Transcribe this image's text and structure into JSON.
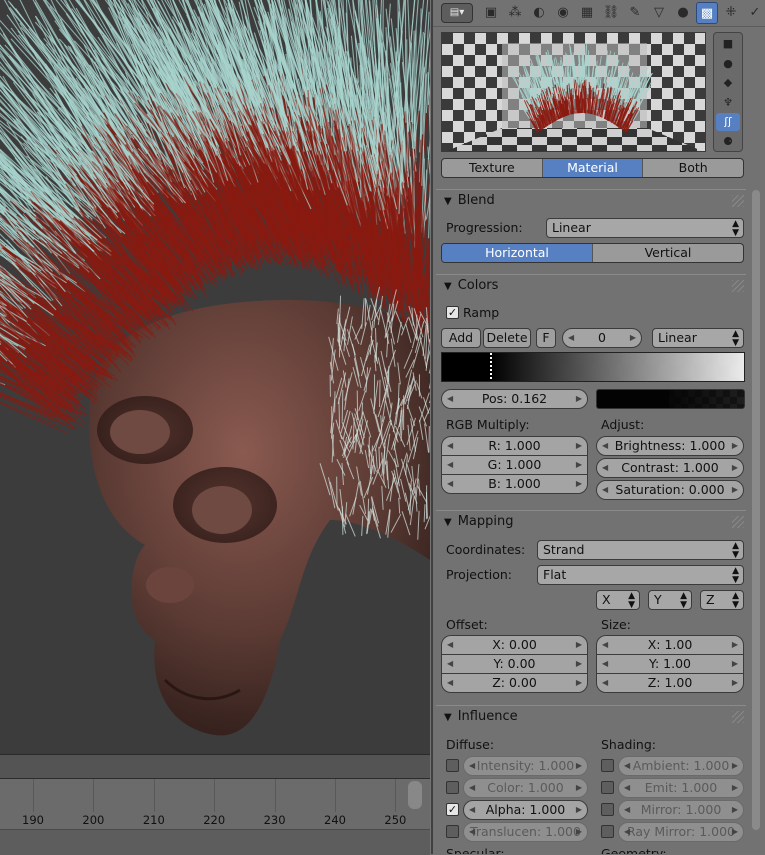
{
  "timeline": {
    "ticks": [
      "190",
      "200",
      "210",
      "220",
      "230",
      "240",
      "250"
    ]
  },
  "header": {
    "editor_type_icon": "properties-editor-icon",
    "context_tabs": [
      {
        "icon": "render-icon",
        "glyph": "▣"
      },
      {
        "icon": "render-layers-icon",
        "glyph": "⁂"
      },
      {
        "icon": "scene-icon",
        "glyph": "◐"
      },
      {
        "icon": "world-icon",
        "glyph": "◉"
      },
      {
        "icon": "object-icon",
        "glyph": "▦"
      },
      {
        "icon": "constraints-icon",
        "glyph": "⛓"
      },
      {
        "icon": "modifiers-icon",
        "glyph": "✎"
      },
      {
        "icon": "data-icon",
        "glyph": "▽"
      },
      {
        "icon": "material-icon",
        "glyph": "●"
      },
      {
        "icon": "texture-icon",
        "glyph": "▩",
        "active": true
      },
      {
        "icon": "particles-icon",
        "glyph": "⁜"
      },
      {
        "icon": "physics-icon",
        "glyph": "✓"
      }
    ]
  },
  "preview": {
    "types": [
      {
        "icon": "plane-preview-icon",
        "glyph": "■"
      },
      {
        "icon": "sphere-preview-icon",
        "glyph": "●"
      },
      {
        "icon": "cube-preview-icon",
        "glyph": "◆"
      },
      {
        "icon": "monkey-preview-icon",
        "glyph": "♆"
      },
      {
        "icon": "hair-preview-icon",
        "glyph": "ʃʃ",
        "active": true
      },
      {
        "icon": "sphere-ring-preview-icon",
        "glyph": "⚈"
      }
    ],
    "modes": [
      "Texture",
      "Material",
      "Both"
    ],
    "active_mode": "Material"
  },
  "blend": {
    "title": "Blend",
    "progression_label": "Progression:",
    "progression_value": "Linear",
    "directions": [
      "Horizontal",
      "Vertical"
    ],
    "active_direction": "Horizontal"
  },
  "colors": {
    "title": "Colors",
    "ramp_label": "Ramp",
    "ramp_checked": true,
    "add_label": "Add",
    "delete_label": "Delete",
    "flip_label": "F",
    "active_index": "0",
    "interpolation": "Linear",
    "pos_label": "Pos: 0.162",
    "stop_color": "#030303",
    "rgb_multiply_label": "RGB Multiply:",
    "r": "R: 1.000",
    "g": "G: 1.000",
    "b": "B: 1.000",
    "adjust_label": "Adjust:",
    "brightness": "Brightness: 1.000",
    "contrast": "Contrast: 1.000",
    "saturation": "Saturation: 0.000"
  },
  "mapping": {
    "title": "Mapping",
    "coordinates_label": "Coordinates:",
    "coordinates_value": "Strand",
    "projection_label": "Projection:",
    "projection_value": "Flat",
    "axes": [
      "X",
      "Y",
      "Z"
    ],
    "offset_label": "Offset:",
    "offset": [
      "X: 0.00",
      "Y: 0.00",
      "Z: 0.00"
    ],
    "size_label": "Size:",
    "size": [
      "X: 1.00",
      "Y: 1.00",
      "Z: 1.00"
    ]
  },
  "influence": {
    "title": "Influence",
    "diffuse_label": "Diffuse:",
    "diffuse": [
      {
        "label": "Intensity: 1.000",
        "checked": false
      },
      {
        "label": "Color: 1.000",
        "checked": false
      },
      {
        "label": "Alpha: 1.000",
        "checked": true
      },
      {
        "label": "Translucen: 1.000",
        "checked": false
      }
    ],
    "shading_label": "Shading:",
    "shading": [
      {
        "label": "Ambient: 1.000",
        "checked": false
      },
      {
        "label": "Emit: 1.000",
        "checked": false
      },
      {
        "label": "Mirror: 1.000",
        "checked": false
      },
      {
        "label": "Ray Mirror: 1.000",
        "checked": false
      }
    ],
    "specular_label": "Specular:",
    "geometry_label": "Geometry:"
  },
  "colors_palette": {
    "accent": "#5680c2",
    "panel_bg": "#727272",
    "viewport_bg": "#3c3c3c",
    "hair_tip": "#a9d5cf",
    "hair_root": "#8b1a10",
    "skin": "#5a3a33"
  }
}
